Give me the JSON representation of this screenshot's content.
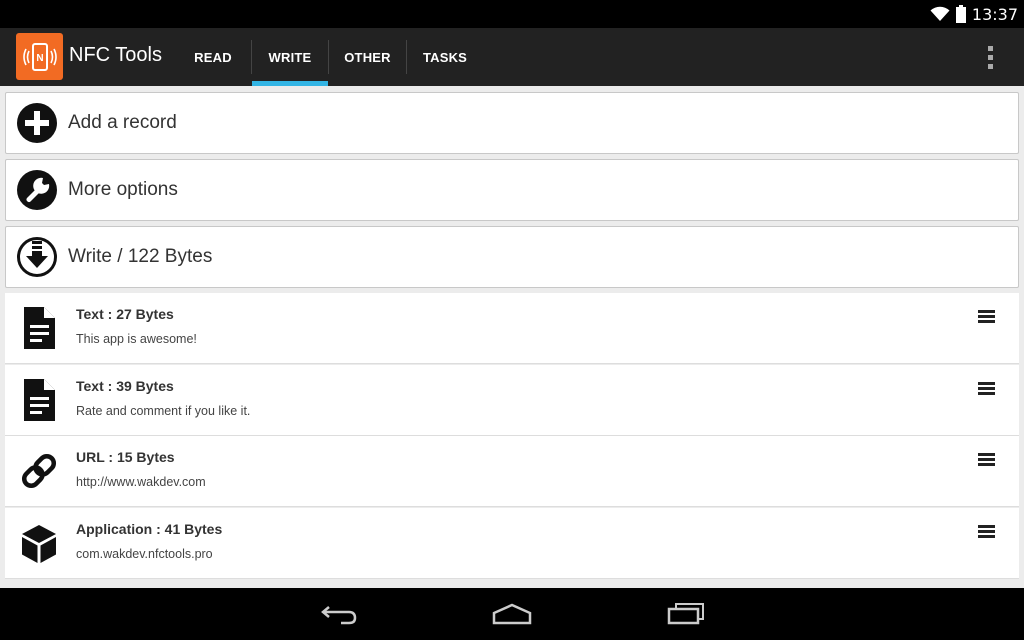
{
  "status_bar": {
    "time": "13:37",
    "wifi_icon": "wifi-icon",
    "battery_icon": "battery-icon"
  },
  "action_bar": {
    "app_title": "NFC Tools",
    "tabs": [
      {
        "label": "READ",
        "active": false
      },
      {
        "label": "WRITE",
        "active": true
      },
      {
        "label": "OTHER",
        "active": false
      },
      {
        "label": "TASKS",
        "active": false
      }
    ],
    "overflow_icon": "overflow-menu-icon",
    "accent_color": "#33b5e5",
    "logo_color": "#f26b23"
  },
  "actions": [
    {
      "label": "Add a record",
      "icon": "add-circle-icon"
    },
    {
      "label": "More options",
      "icon": "wrench-icon"
    },
    {
      "label": "Write / 122 Bytes",
      "icon": "download-circle-icon"
    }
  ],
  "records": [
    {
      "title": "Text : 27 Bytes",
      "subtitle": "This app is awesome!",
      "icon": "document-icon"
    },
    {
      "title": "Text : 39 Bytes",
      "subtitle": "Rate and comment if you like it.",
      "icon": "document-icon"
    },
    {
      "title": "URL : 15 Bytes",
      "subtitle": "http://www.wakdev.com",
      "icon": "link-icon"
    },
    {
      "title": "Application : 41 Bytes",
      "subtitle": "com.wakdev.nfctools.pro",
      "icon": "cube-icon"
    }
  ],
  "nav_bar": {
    "back_icon": "back-icon",
    "home_icon": "home-icon",
    "recents_icon": "recents-icon"
  }
}
